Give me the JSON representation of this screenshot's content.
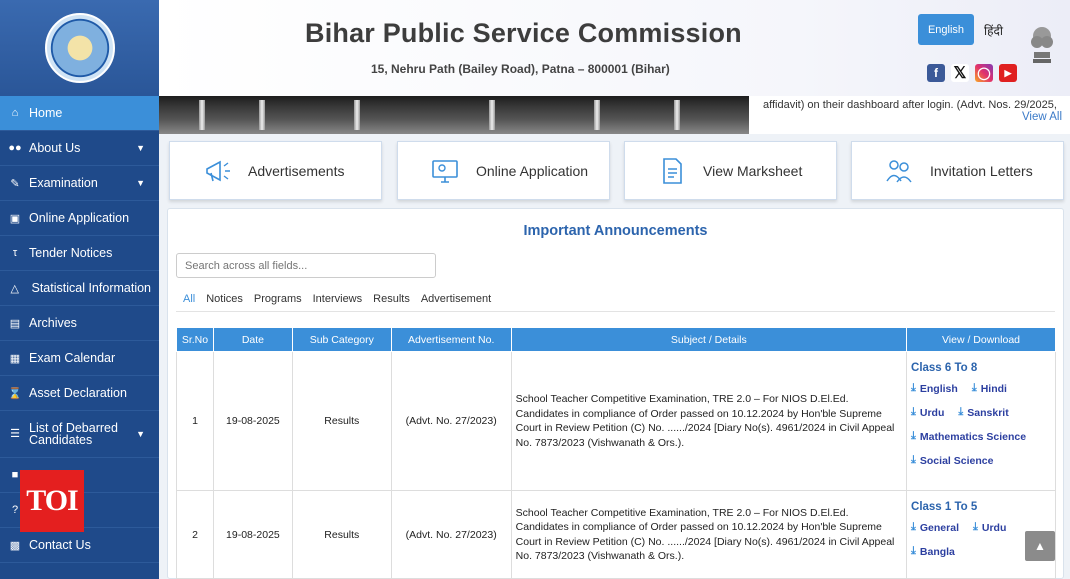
{
  "header": {
    "title": "Bihar Public Service Commission",
    "address": "15, Nehru Path (Bailey Road), Patna – 800001 (Bihar)",
    "lang_en": "English",
    "lang_hi": "हिंदी"
  },
  "ticker": {
    "text": "affidavit) on their dashboard after login. (Advt. Nos. 29/2025,",
    "view_all": "View All"
  },
  "sidebar": {
    "items": [
      {
        "label": "Home",
        "icon": "home-icon"
      },
      {
        "label": "About Us",
        "icon": "users-icon"
      },
      {
        "label": "Examination",
        "icon": "pen-icon"
      },
      {
        "label": "Online Application",
        "icon": "monitor-icon"
      },
      {
        "label": "Tender Notices",
        "icon": "tender-icon"
      },
      {
        "label": "Statistical Information",
        "icon": "chart-icon"
      },
      {
        "label": "Archives",
        "icon": "archive-icon"
      },
      {
        "label": "Exam Calendar",
        "icon": "calendar-icon"
      },
      {
        "label": "Asset Declaration",
        "icon": "hourglass-icon"
      },
      {
        "label": "List of Debarred Candidates",
        "icon": "list-icon"
      },
      {
        "label": "Contact Us",
        "icon": "contact-icon"
      }
    ],
    "watermark": "TOI"
  },
  "quick_links": [
    {
      "label": "Advertisements"
    },
    {
      "label": "Online Application"
    },
    {
      "label": "View Marksheet"
    },
    {
      "label": "Invitation Letters"
    }
  ],
  "announcements": {
    "title": "Important Announcements",
    "search_placeholder": "Search across all fields...",
    "filters": [
      "All",
      "Notices",
      "Programs",
      "Interviews",
      "Results",
      "Advertisement"
    ],
    "columns": [
      "Sr.No",
      "Date",
      "Sub Category",
      "Advertisement No.",
      "Subject / Details",
      "View / Download"
    ],
    "rows": [
      {
        "sr": "1",
        "date": "19-08-2025",
        "category": "Results",
        "advt": "(Advt. No. 27/2023)",
        "subject": "School Teacher Competitive Examination, TRE 2.0 – For NIOS D.El.Ed. Candidates in compliance of Order passed on 10.12.2024 by Hon'ble Supreme Court in Review Petition (C) No. ....../2024 [Diary No(s). 4961/2024 in Civil Appeal No. 7873/2023 (Vishwanath & Ors.).",
        "class": "Class 6 To 8",
        "links": [
          [
            "English",
            "Hindi"
          ],
          [
            "Urdu",
            "Sanskrit"
          ],
          [
            "Mathematics Science"
          ],
          [
            "Social Science"
          ]
        ]
      },
      {
        "sr": "2",
        "date": "19-08-2025",
        "category": "Results",
        "advt": "(Advt. No. 27/2023)",
        "subject": "School Teacher Competitive Examination, TRE 2.0 – For NIOS D.El.Ed. Candidates in compliance of Order passed on 10.12.2024 by Hon'ble Supreme Court in Review Petition (C) No. ....../2024 [Diary No(s). 4961/2024 in Civil Appeal No. 7873/2023 (Vishwanath & Ors.).",
        "class": "Class 1 To 5",
        "links": [
          [
            "General",
            "Urdu"
          ],
          [
            "Bangla"
          ]
        ]
      }
    ]
  },
  "colors": {
    "accent": "#3b8fd9",
    "sidebar": "#1f4a8a",
    "title_blue": "#2c64ad"
  }
}
